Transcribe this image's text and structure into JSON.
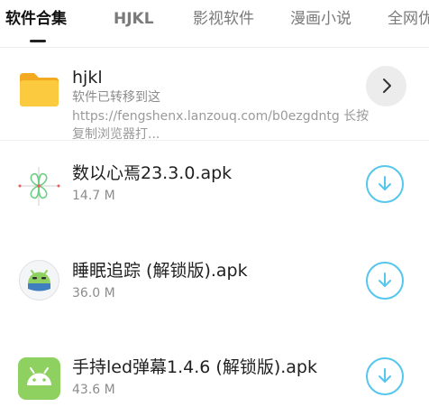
{
  "tabs": [
    {
      "label": "软件合集",
      "active": true
    },
    {
      "label": "HJKL",
      "active": false
    },
    {
      "label": "影视软件",
      "active": false
    },
    {
      "label": "漫画小说",
      "active": false
    },
    {
      "label": "全网优",
      "active": false
    }
  ],
  "folder": {
    "icon": "folder-icon",
    "title": "hjkl",
    "subtitle": "软件已转移到这",
    "description": "https://fengshenx.lanzouq.com/b0ezgdntg 长按复制浏览器打...",
    "action_icon": "chevron-right-icon"
  },
  "apps": [
    {
      "icon": "clover-app-icon",
      "name": "数以心焉23.3.0.apk",
      "size": "14.7 M",
      "action_icon": "download-icon"
    },
    {
      "icon": "android-sleep-app-icon",
      "name": "睡眠追踪 (解锁版).apk",
      "size": "36.0 M",
      "action_icon": "download-icon"
    },
    {
      "icon": "android-app-icon",
      "name": "手持led弹幕1.4.6 (解锁版).apk",
      "size": "43.6 M",
      "action_icon": "download-icon"
    }
  ],
  "colors": {
    "accent": "#55c6ec",
    "folder": "#f8c13a",
    "android_green": "#8fd161"
  }
}
